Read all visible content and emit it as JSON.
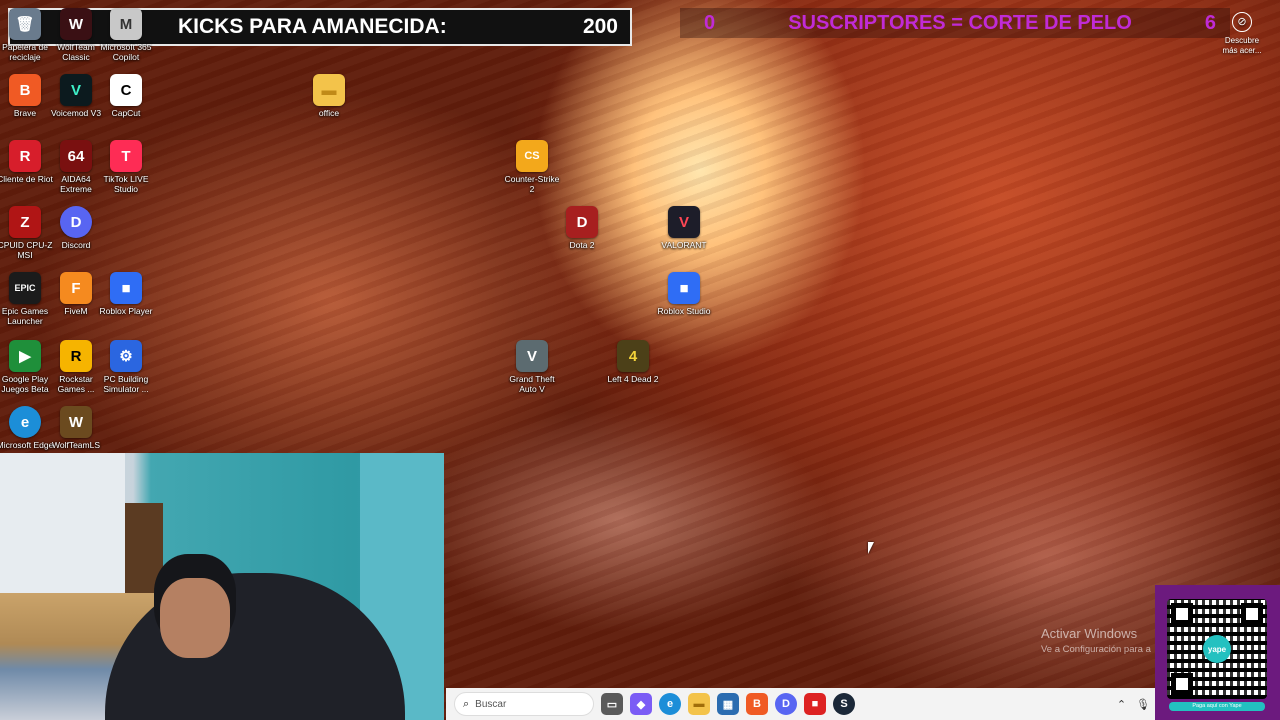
{
  "overlay": {
    "kicks_label": "KICKS PARA AMANECIDA:",
    "kicks_value": "200",
    "subs_left": "0",
    "subs_label": "SUSCRIPTORES = CORTE DE PELO",
    "subs_right": "6"
  },
  "desktop": {
    "icons": [
      {
        "label": "Papelera de reciclaje",
        "glyph": "🗑",
        "color": "#6a7b8d"
      },
      {
        "label": "WolfTeam Classic",
        "glyph": "W",
        "color": "#3a1014"
      },
      {
        "label": "Microsoft 365 Copilot",
        "glyph": "M",
        "color": "#c8c8c8"
      },
      {
        "label": "Brave",
        "glyph": "B",
        "color": "#f05a24"
      },
      {
        "label": "Voicemod V3",
        "glyph": "V",
        "color": "#0c1a1e"
      },
      {
        "label": "CapCut",
        "glyph": "C",
        "color": "#ffffff"
      },
      {
        "label": "office",
        "glyph": "▬",
        "color": "#f3c34a"
      },
      {
        "label": "Cliente de Riot",
        "glyph": "R",
        "color": "#d71e2b"
      },
      {
        "label": "AIDA64 Extreme",
        "glyph": "64",
        "color": "#7a1010"
      },
      {
        "label": "TikTok LIVE Studio",
        "glyph": "T",
        "color": "#fe2c55"
      },
      {
        "label": "CPUID CPU-Z MSI",
        "glyph": "Z",
        "color": "#b01515"
      },
      {
        "label": "Discord",
        "glyph": "D",
        "color": "#5865f2"
      },
      {
        "label": "Epic Games Launcher",
        "glyph": "EPIC",
        "color": "#1b1b1b"
      },
      {
        "label": "FiveM",
        "glyph": "F",
        "color": "#f58a1f"
      },
      {
        "label": "Roblox Player",
        "glyph": "■",
        "color": "#2f6df5"
      },
      {
        "label": "Google Play Juegos Beta",
        "glyph": "▶",
        "color": "#1f8f3a"
      },
      {
        "label": "Rockstar Games ...",
        "glyph": "R",
        "color": "#f6b400"
      },
      {
        "label": "PC Building Simulator ...",
        "glyph": "⚙",
        "color": "#2b66e0"
      },
      {
        "label": "Microsoft Edge",
        "glyph": "e",
        "color": "#1c8ed8"
      },
      {
        "label": "WolfTeamLS",
        "glyph": "W",
        "color": "#6b4a1f"
      },
      {
        "label": "Counter-Strike 2",
        "glyph": "CS",
        "color": "#f3a81b"
      },
      {
        "label": "Dota 2",
        "glyph": "D",
        "color": "#a71f1f"
      },
      {
        "label": "VALORANT",
        "glyph": "V",
        "color": "#1d1d29"
      },
      {
        "label": "Roblox Studio",
        "glyph": "■",
        "color": "#2f6df5"
      },
      {
        "label": "Grand Theft Auto V",
        "glyph": "V",
        "color": "#5c6b70"
      },
      {
        "label": "Left 4 Dead 2",
        "glyph": "4",
        "color": "#4c4018"
      }
    ],
    "discover_label": "Descubre más acer..."
  },
  "taskbar": {
    "search_placeholder": "Buscar",
    "apps": [
      {
        "name": "task-view",
        "glyph": "▭",
        "color": "#5a5a5a"
      },
      {
        "name": "copilot",
        "glyph": "◆",
        "color": "#7b5cf5"
      },
      {
        "name": "edge",
        "glyph": "e",
        "color": "#1c8ed8"
      },
      {
        "name": "file-explorer",
        "glyph": "▬",
        "color": "#f3c34a"
      },
      {
        "name": "store",
        "glyph": "▦",
        "color": "#2b6cb0"
      },
      {
        "name": "brave",
        "glyph": "B",
        "color": "#f05a24"
      },
      {
        "name": "discord",
        "glyph": "D",
        "color": "#5865f2"
      },
      {
        "name": "roblox",
        "glyph": "■",
        "color": "#d22"
      },
      {
        "name": "steam",
        "glyph": "S",
        "color": "#1b2838"
      }
    ]
  },
  "activation": {
    "title": "Activar Windows",
    "subtitle": "Ve a Configuración para a"
  },
  "qr": {
    "logo": "yape",
    "caption": "Paga aquí con Yape"
  }
}
